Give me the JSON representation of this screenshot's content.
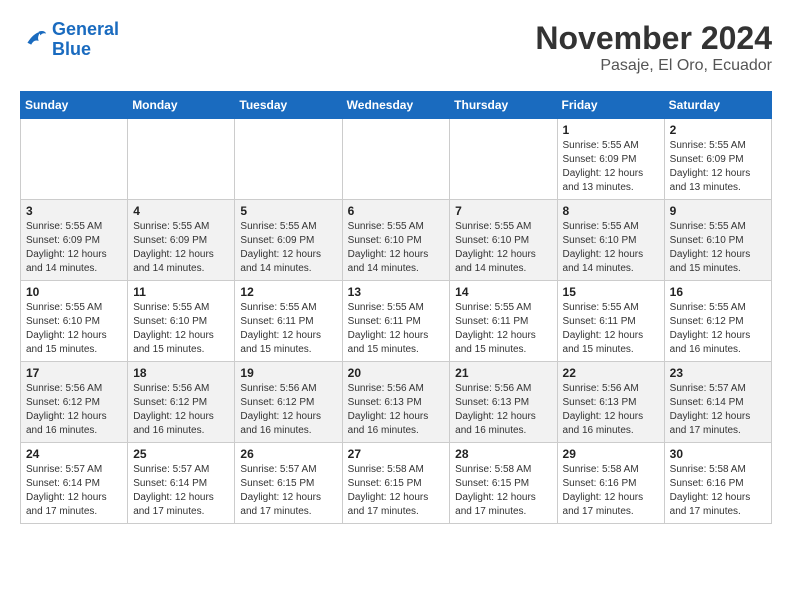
{
  "header": {
    "logo_line1": "General",
    "logo_line2": "Blue",
    "title": "November 2024",
    "subtitle": "Pasaje, El Oro, Ecuador"
  },
  "days_of_week": [
    "Sunday",
    "Monday",
    "Tuesday",
    "Wednesday",
    "Thursday",
    "Friday",
    "Saturday"
  ],
  "weeks": [
    [
      {
        "day": "",
        "info": ""
      },
      {
        "day": "",
        "info": ""
      },
      {
        "day": "",
        "info": ""
      },
      {
        "day": "",
        "info": ""
      },
      {
        "day": "",
        "info": ""
      },
      {
        "day": "1",
        "info": "Sunrise: 5:55 AM\nSunset: 6:09 PM\nDaylight: 12 hours and 13 minutes."
      },
      {
        "day": "2",
        "info": "Sunrise: 5:55 AM\nSunset: 6:09 PM\nDaylight: 12 hours and 13 minutes."
      }
    ],
    [
      {
        "day": "3",
        "info": "Sunrise: 5:55 AM\nSunset: 6:09 PM\nDaylight: 12 hours and 14 minutes."
      },
      {
        "day": "4",
        "info": "Sunrise: 5:55 AM\nSunset: 6:09 PM\nDaylight: 12 hours and 14 minutes."
      },
      {
        "day": "5",
        "info": "Sunrise: 5:55 AM\nSunset: 6:09 PM\nDaylight: 12 hours and 14 minutes."
      },
      {
        "day": "6",
        "info": "Sunrise: 5:55 AM\nSunset: 6:10 PM\nDaylight: 12 hours and 14 minutes."
      },
      {
        "day": "7",
        "info": "Sunrise: 5:55 AM\nSunset: 6:10 PM\nDaylight: 12 hours and 14 minutes."
      },
      {
        "day": "8",
        "info": "Sunrise: 5:55 AM\nSunset: 6:10 PM\nDaylight: 12 hours and 14 minutes."
      },
      {
        "day": "9",
        "info": "Sunrise: 5:55 AM\nSunset: 6:10 PM\nDaylight: 12 hours and 15 minutes."
      }
    ],
    [
      {
        "day": "10",
        "info": "Sunrise: 5:55 AM\nSunset: 6:10 PM\nDaylight: 12 hours and 15 minutes."
      },
      {
        "day": "11",
        "info": "Sunrise: 5:55 AM\nSunset: 6:10 PM\nDaylight: 12 hours and 15 minutes."
      },
      {
        "day": "12",
        "info": "Sunrise: 5:55 AM\nSunset: 6:11 PM\nDaylight: 12 hours and 15 minutes."
      },
      {
        "day": "13",
        "info": "Sunrise: 5:55 AM\nSunset: 6:11 PM\nDaylight: 12 hours and 15 minutes."
      },
      {
        "day": "14",
        "info": "Sunrise: 5:55 AM\nSunset: 6:11 PM\nDaylight: 12 hours and 15 minutes."
      },
      {
        "day": "15",
        "info": "Sunrise: 5:55 AM\nSunset: 6:11 PM\nDaylight: 12 hours and 15 minutes."
      },
      {
        "day": "16",
        "info": "Sunrise: 5:55 AM\nSunset: 6:12 PM\nDaylight: 12 hours and 16 minutes."
      }
    ],
    [
      {
        "day": "17",
        "info": "Sunrise: 5:56 AM\nSunset: 6:12 PM\nDaylight: 12 hours and 16 minutes."
      },
      {
        "day": "18",
        "info": "Sunrise: 5:56 AM\nSunset: 6:12 PM\nDaylight: 12 hours and 16 minutes."
      },
      {
        "day": "19",
        "info": "Sunrise: 5:56 AM\nSunset: 6:12 PM\nDaylight: 12 hours and 16 minutes."
      },
      {
        "day": "20",
        "info": "Sunrise: 5:56 AM\nSunset: 6:13 PM\nDaylight: 12 hours and 16 minutes."
      },
      {
        "day": "21",
        "info": "Sunrise: 5:56 AM\nSunset: 6:13 PM\nDaylight: 12 hours and 16 minutes."
      },
      {
        "day": "22",
        "info": "Sunrise: 5:56 AM\nSunset: 6:13 PM\nDaylight: 12 hours and 16 minutes."
      },
      {
        "day": "23",
        "info": "Sunrise: 5:57 AM\nSunset: 6:14 PM\nDaylight: 12 hours and 17 minutes."
      }
    ],
    [
      {
        "day": "24",
        "info": "Sunrise: 5:57 AM\nSunset: 6:14 PM\nDaylight: 12 hours and 17 minutes."
      },
      {
        "day": "25",
        "info": "Sunrise: 5:57 AM\nSunset: 6:14 PM\nDaylight: 12 hours and 17 minutes."
      },
      {
        "day": "26",
        "info": "Sunrise: 5:57 AM\nSunset: 6:15 PM\nDaylight: 12 hours and 17 minutes."
      },
      {
        "day": "27",
        "info": "Sunrise: 5:58 AM\nSunset: 6:15 PM\nDaylight: 12 hours and 17 minutes."
      },
      {
        "day": "28",
        "info": "Sunrise: 5:58 AM\nSunset: 6:15 PM\nDaylight: 12 hours and 17 minutes."
      },
      {
        "day": "29",
        "info": "Sunrise: 5:58 AM\nSunset: 6:16 PM\nDaylight: 12 hours and 17 minutes."
      },
      {
        "day": "30",
        "info": "Sunrise: 5:58 AM\nSunset: 6:16 PM\nDaylight: 12 hours and 17 minutes."
      }
    ]
  ]
}
